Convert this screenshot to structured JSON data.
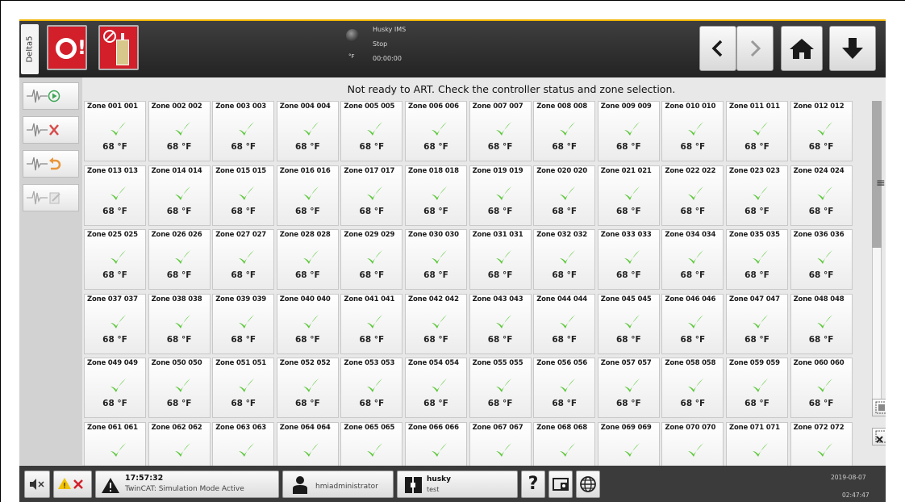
{
  "header": {
    "machine_tab": "Delta5",
    "machine_name": "Husky IMS",
    "machine_state": "Stop",
    "machine_time": "00:00:00",
    "lamp_unit": "°F"
  },
  "toolbar": {
    "items": [
      {
        "icon": "wave-play-icon"
      },
      {
        "icon": "wave-cancel-icon"
      },
      {
        "icon": "wave-undo-icon"
      },
      {
        "icon": "wave-edit-icon"
      }
    ]
  },
  "message": "Not ready to ART. Check the controller status and zone selection.",
  "zones": [
    {
      "name": "Zone 001",
      "num": "001",
      "temp": "68 °F"
    },
    {
      "name": "Zone 002",
      "num": "002",
      "temp": "68 °F"
    },
    {
      "name": "Zone 003",
      "num": "003",
      "temp": "68 °F"
    },
    {
      "name": "Zone 004",
      "num": "004",
      "temp": "68 °F"
    },
    {
      "name": "Zone 005",
      "num": "005",
      "temp": "68 °F"
    },
    {
      "name": "Zone 006",
      "num": "006",
      "temp": "68 °F"
    },
    {
      "name": "Zone 007",
      "num": "007",
      "temp": "68 °F"
    },
    {
      "name": "Zone 008",
      "num": "008",
      "temp": "68 °F"
    },
    {
      "name": "Zone 009",
      "num": "009",
      "temp": "68 °F"
    },
    {
      "name": "Zone 010",
      "num": "010",
      "temp": "68 °F"
    },
    {
      "name": "Zone 011",
      "num": "011",
      "temp": "68 °F"
    },
    {
      "name": "Zone 012",
      "num": "012",
      "temp": "68 °F"
    },
    {
      "name": "Zone 013",
      "num": "013",
      "temp": "68 °F"
    },
    {
      "name": "Zone 014",
      "num": "014",
      "temp": "68 °F"
    },
    {
      "name": "Zone 015",
      "num": "015",
      "temp": "68 °F"
    },
    {
      "name": "Zone 016",
      "num": "016",
      "temp": "68 °F"
    },
    {
      "name": "Zone 017",
      "num": "017",
      "temp": "68 °F"
    },
    {
      "name": "Zone 018",
      "num": "018",
      "temp": "68 °F"
    },
    {
      "name": "Zone 019",
      "num": "019",
      "temp": "68 °F"
    },
    {
      "name": "Zone 020",
      "num": "020",
      "temp": "68 °F"
    },
    {
      "name": "Zone 021",
      "num": "021",
      "temp": "68 °F"
    },
    {
      "name": "Zone 022",
      "num": "022",
      "temp": "68 °F"
    },
    {
      "name": "Zone 023",
      "num": "023",
      "temp": "68 °F"
    },
    {
      "name": "Zone 024",
      "num": "024",
      "temp": "68 °F"
    },
    {
      "name": "Zone 025",
      "num": "025",
      "temp": "68 °F"
    },
    {
      "name": "Zone 026",
      "num": "026",
      "temp": "68 °F"
    },
    {
      "name": "Zone 027",
      "num": "027",
      "temp": "68 °F"
    },
    {
      "name": "Zone 028",
      "num": "028",
      "temp": "68 °F"
    },
    {
      "name": "Zone 029",
      "num": "029",
      "temp": "68 °F"
    },
    {
      "name": "Zone 030",
      "num": "030",
      "temp": "68 °F"
    },
    {
      "name": "Zone 031",
      "num": "031",
      "temp": "68 °F"
    },
    {
      "name": "Zone 032",
      "num": "032",
      "temp": "68 °F"
    },
    {
      "name": "Zone 033",
      "num": "033",
      "temp": "68 °F"
    },
    {
      "name": "Zone 034",
      "num": "034",
      "temp": "68 °F"
    },
    {
      "name": "Zone 035",
      "num": "035",
      "temp": "68 °F"
    },
    {
      "name": "Zone 036",
      "num": "036",
      "temp": "68 °F"
    },
    {
      "name": "Zone 037",
      "num": "037",
      "temp": "68 °F"
    },
    {
      "name": "Zone 038",
      "num": "038",
      "temp": "68 °F"
    },
    {
      "name": "Zone 039",
      "num": "039",
      "temp": "68 °F"
    },
    {
      "name": "Zone 040",
      "num": "040",
      "temp": "68 °F"
    },
    {
      "name": "Zone 041",
      "num": "041",
      "temp": "68 °F"
    },
    {
      "name": "Zone 042",
      "num": "042",
      "temp": "68 °F"
    },
    {
      "name": "Zone 043",
      "num": "043",
      "temp": "68 °F"
    },
    {
      "name": "Zone 044",
      "num": "044",
      "temp": "68 °F"
    },
    {
      "name": "Zone 045",
      "num": "045",
      "temp": "68 °F"
    },
    {
      "name": "Zone 046",
      "num": "046",
      "temp": "68 °F"
    },
    {
      "name": "Zone 047",
      "num": "047",
      "temp": "68 °F"
    },
    {
      "name": "Zone 048",
      "num": "048",
      "temp": "68 °F"
    },
    {
      "name": "Zone 049",
      "num": "049",
      "temp": "68 °F"
    },
    {
      "name": "Zone 050",
      "num": "050",
      "temp": "68 °F"
    },
    {
      "name": "Zone 051",
      "num": "051",
      "temp": "68 °F"
    },
    {
      "name": "Zone 052",
      "num": "052",
      "temp": "68 °F"
    },
    {
      "name": "Zone 053",
      "num": "053",
      "temp": "68 °F"
    },
    {
      "name": "Zone 054",
      "num": "054",
      "temp": "68 °F"
    },
    {
      "name": "Zone 055",
      "num": "055",
      "temp": "68 °F"
    },
    {
      "name": "Zone 056",
      "num": "056",
      "temp": "68 °F"
    },
    {
      "name": "Zone 057",
      "num": "057",
      "temp": "68 °F"
    },
    {
      "name": "Zone 058",
      "num": "058",
      "temp": "68 °F"
    },
    {
      "name": "Zone 059",
      "num": "059",
      "temp": "68 °F"
    },
    {
      "name": "Zone 060",
      "num": "060",
      "temp": "68 °F"
    },
    {
      "name": "Zone 061",
      "num": "061",
      "temp": ""
    },
    {
      "name": "Zone 062",
      "num": "062",
      "temp": ""
    },
    {
      "name": "Zone 063",
      "num": "063",
      "temp": ""
    },
    {
      "name": "Zone 064",
      "num": "064",
      "temp": ""
    },
    {
      "name": "Zone 065",
      "num": "065",
      "temp": ""
    },
    {
      "name": "Zone 066",
      "num": "066",
      "temp": ""
    },
    {
      "name": "Zone 067",
      "num": "067",
      "temp": ""
    },
    {
      "name": "Zone 068",
      "num": "068",
      "temp": ""
    },
    {
      "name": "Zone 069",
      "num": "069",
      "temp": ""
    },
    {
      "name": "Zone 070",
      "num": "070",
      "temp": ""
    },
    {
      "name": "Zone 071",
      "num": "071",
      "temp": ""
    },
    {
      "name": "Zone 072",
      "num": "072",
      "temp": ""
    }
  ],
  "statusbar": {
    "alarm_time": "17:57:32",
    "alarm_text": "TwinCAT: Simulation Mode Active",
    "user": "hmiadministrator",
    "mold_name": "husky",
    "mold_sub": "test",
    "help": "?",
    "date": "2019-08-07",
    "clock": "02:47:47"
  },
  "colors": {
    "alarm_red": "#d21f2a",
    "ok_green": "#5cc83a",
    "accent_gold": "#f0b400"
  }
}
